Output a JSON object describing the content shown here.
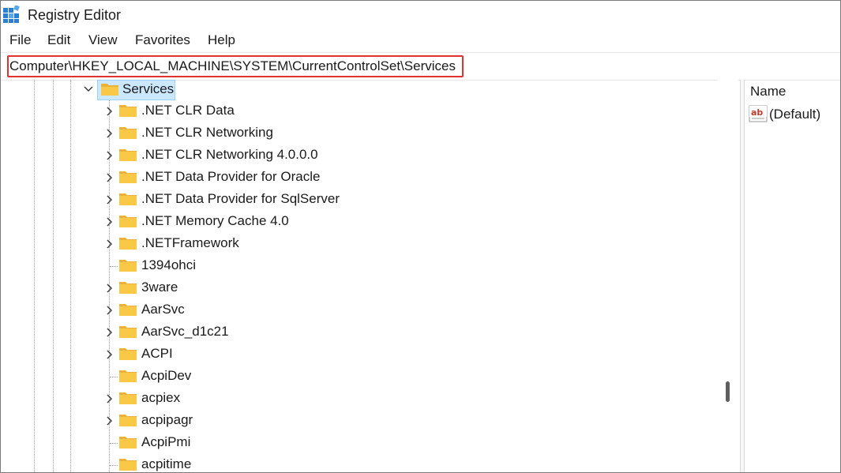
{
  "window": {
    "title": "Registry Editor"
  },
  "menu": [
    {
      "label": "File"
    },
    {
      "label": "Edit"
    },
    {
      "label": "View"
    },
    {
      "label": "Favorites"
    },
    {
      "label": "Help"
    }
  ],
  "address": {
    "value": "Computer\\HKEY_LOCAL_MACHINE\\SYSTEM\\CurrentControlSet\\Services"
  },
  "tree": {
    "selected": {
      "label": "Services",
      "expanded": true
    },
    "children": [
      {
        "label": ".NET CLR Data",
        "expandable": true
      },
      {
        "label": ".NET CLR Networking",
        "expandable": true
      },
      {
        "label": ".NET CLR Networking 4.0.0.0",
        "expandable": true
      },
      {
        "label": ".NET Data Provider for Oracle",
        "expandable": true
      },
      {
        "label": ".NET Data Provider for SqlServer",
        "expandable": true
      },
      {
        "label": ".NET Memory Cache 4.0",
        "expandable": true
      },
      {
        "label": ".NETFramework",
        "expandable": true
      },
      {
        "label": "1394ohci",
        "expandable": false
      },
      {
        "label": "3ware",
        "expandable": true
      },
      {
        "label": "AarSvc",
        "expandable": true
      },
      {
        "label": "AarSvc_d1c21",
        "expandable": true
      },
      {
        "label": "ACPI",
        "expandable": true
      },
      {
        "label": "AcpiDev",
        "expandable": false
      },
      {
        "label": "acpiex",
        "expandable": true
      },
      {
        "label": "acpipagr",
        "expandable": true
      },
      {
        "label": "AcpiPmi",
        "expandable": false
      },
      {
        "label": "acpitime",
        "expandable": false
      }
    ]
  },
  "values": {
    "header": "Name",
    "items": [
      {
        "name": "(Default)",
        "icon": "string-value-icon"
      }
    ]
  },
  "colors": {
    "selection_bg": "#cce8ff",
    "selection_border": "#99d1ff",
    "folder_yellow": "#f8c846",
    "highlight_red": "#e0322e"
  }
}
